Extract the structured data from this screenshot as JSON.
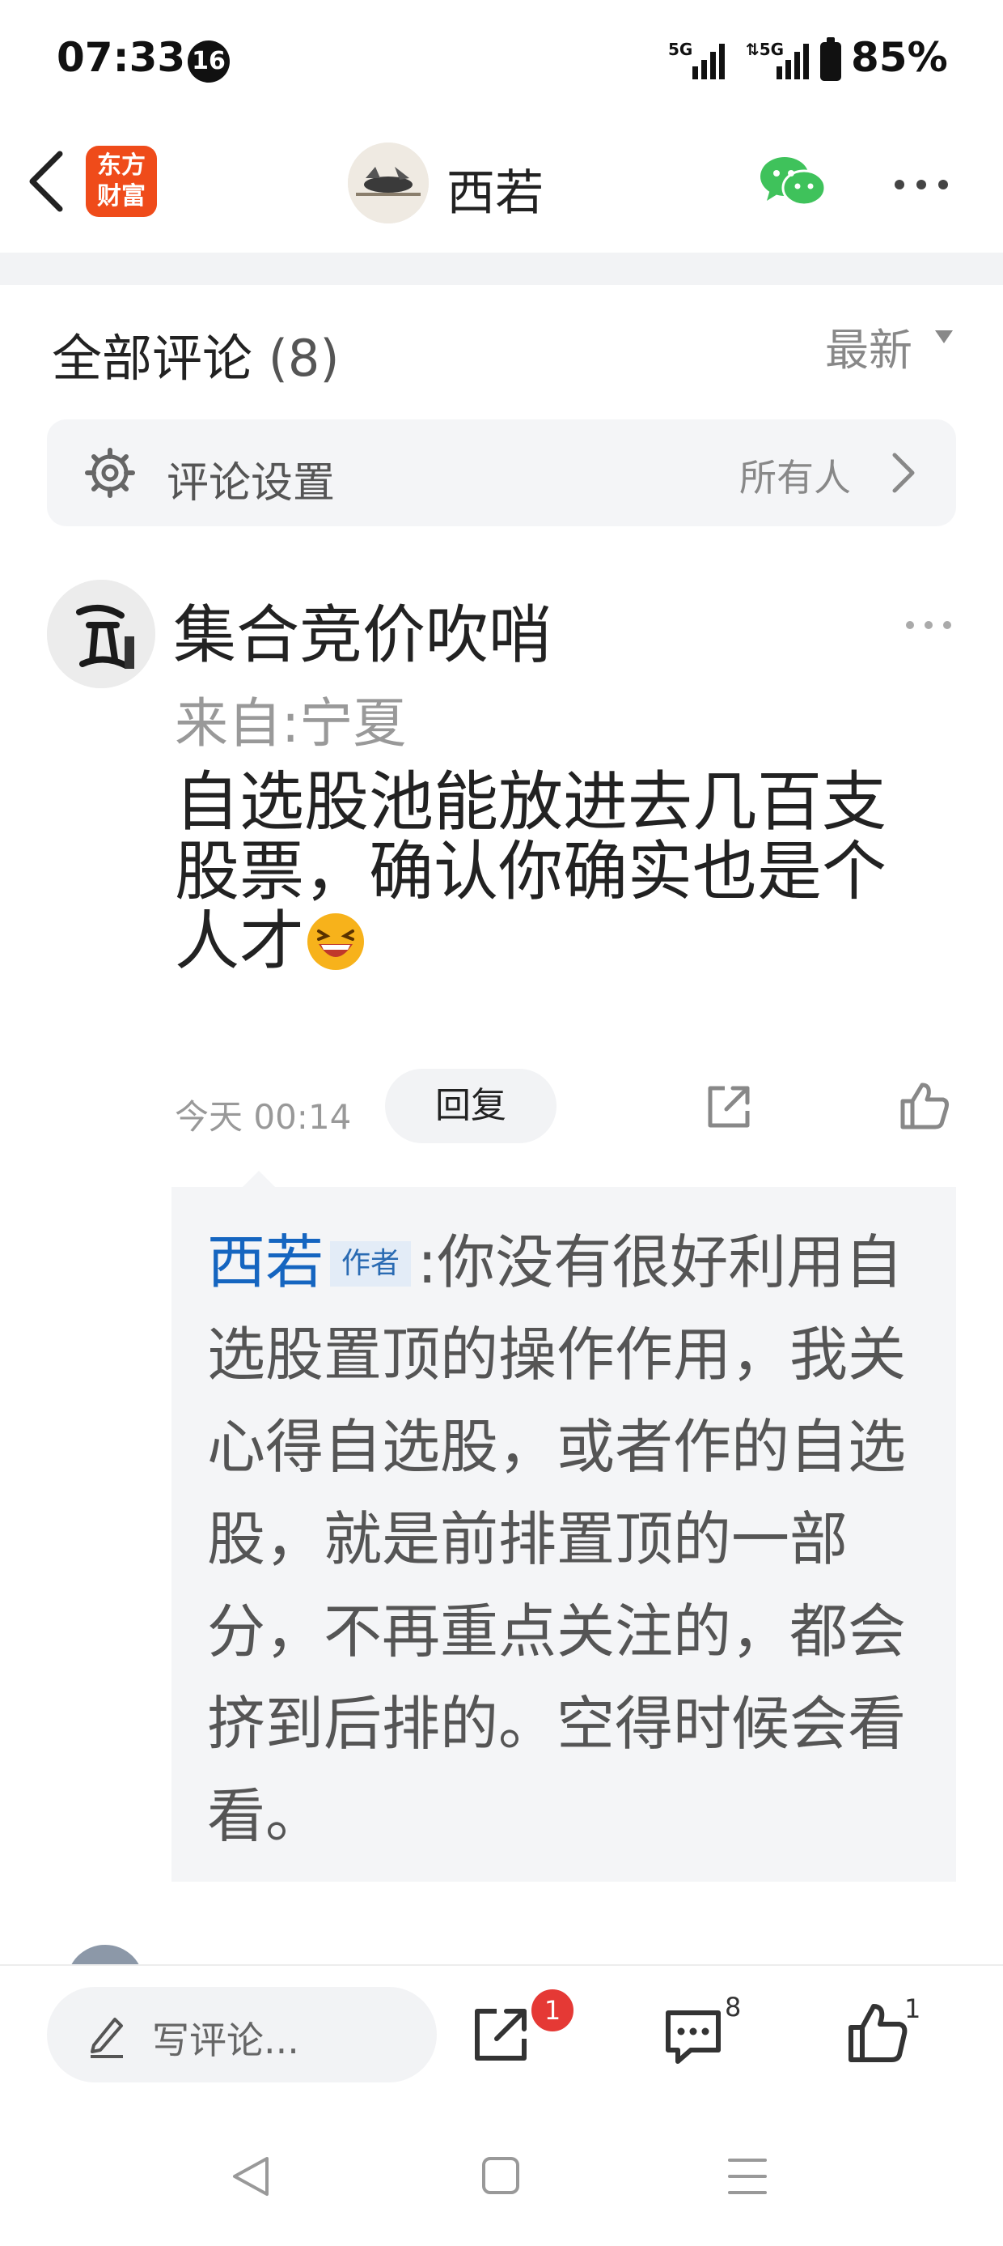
{
  "status_bar": {
    "time": "07:33",
    "notification_count": "16",
    "battery": "85%"
  },
  "header": {
    "app_logo_line1": "东方",
    "app_logo_line2": "财富",
    "author_name": "西若"
  },
  "comments_header": {
    "title": "全部评论",
    "count": "(8)",
    "sort_label": "最新"
  },
  "settings": {
    "label": "评论设置",
    "value": "所有人"
  },
  "comment": {
    "username": "集合竞价吹哨",
    "location": "来自:宁夏",
    "text": "自选股池能放进去几百支股票，确认你确实也是个人才",
    "time": "今天 00:14",
    "reply_button": "回复"
  },
  "reply": {
    "author": "西若",
    "author_tag": "作者",
    "separator": ":",
    "text": "你没有很好利用自选股置顶的操作作用，我关心得自选股，或者作的自选股，就是前排置顶的一部分，不再重点关注的，都会挤到后排的。空得时候会看看。"
  },
  "bottom_bar": {
    "write_placeholder": "写评论...",
    "share_badge": "1",
    "comment_count": "8",
    "like_count": "1"
  },
  "colors": {
    "accent_orange": "#ef4b1a",
    "reply_author_blue": "#1565c0",
    "badge_red": "#e53935",
    "wechat_green": "#3fc25b"
  }
}
